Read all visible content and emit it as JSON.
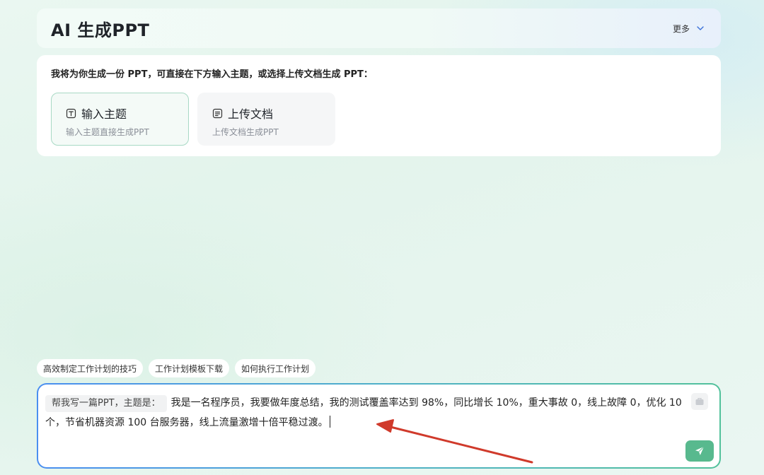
{
  "header": {
    "title": "AI 生成PPT",
    "more_label": "更多"
  },
  "panel": {
    "intro": "我将为你生成一份 PPT，可直接在下方输入主题，或选择上传文档生成 PPT：",
    "options": [
      {
        "title": "输入主题",
        "subtitle": "输入主题直接生成PPT",
        "icon": "text-t-icon",
        "active": true
      },
      {
        "title": "上传文档",
        "subtitle": "上传文档生成PPT",
        "icon": "document-icon",
        "active": false
      }
    ]
  },
  "suggestions": [
    "高效制定工作计划的技巧",
    "工作计划模板下载",
    "如何执行工作计划"
  ],
  "input": {
    "prompt_tag": "帮我写一篇PPT，主题是：",
    "value": "我是一名程序员，我要做年度总结，我的测试覆盖率达到 98%，同比增长 10%，重大事故 0，线上故障 0，优化 10 个，节省机器资源 100 台服务器，线上流量激增十倍平稳过渡。"
  },
  "icons": {
    "more": "chevron-down-icon",
    "attach": "briefcase-icon",
    "send": "send-icon"
  },
  "colors": {
    "accent": "#58b98e",
    "active_border": "#a8d9c5",
    "annotation_arrow": "#d03a2b"
  }
}
